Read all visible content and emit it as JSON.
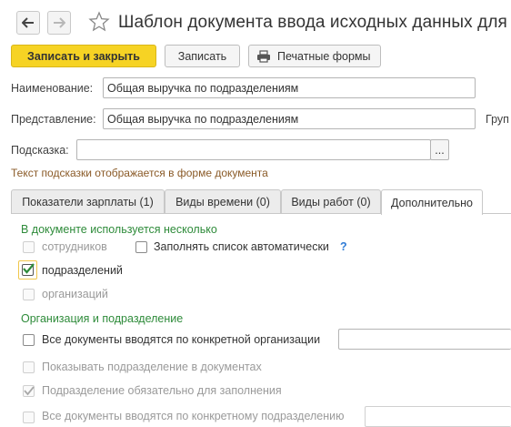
{
  "window": {
    "title": "Шаблон документа ввода исходных данных для ра"
  },
  "toolbar": {
    "save_close_label": "Записать и закрыть",
    "save_label": "Записать",
    "print_forms_label": "Печатные формы"
  },
  "form": {
    "name_label": "Наименование:",
    "name_value": "Общая выручка по подразделениям",
    "representation_label": "Представление:",
    "representation_value": "Общая выручка по подразделениям",
    "group_label_fragment": "Груп",
    "hint_label": "Подсказка:",
    "hint_value": "",
    "hint_button": "...",
    "hint_note": "Текст подсказки отображается в форме документа"
  },
  "tabs": [
    {
      "label": "Показатели зарплаты (1)"
    },
    {
      "label": "Виды времени (0)"
    },
    {
      "label": "Виды работ (0)"
    },
    {
      "label": "Дополнительно"
    }
  ],
  "additional": {
    "section1_title": "В документе используется несколько",
    "employees_label": "сотрудников",
    "autofill_label": "Заполнять список автоматически",
    "help_mark": "?",
    "departments_label": "подразделений",
    "organizations_label": "организаций",
    "section2_title": "Организация и подразделение",
    "all_docs_org_label": "Все документы вводятся по конкретной организации",
    "show_dept_label": "Показывать подразделение в документах",
    "dept_required_label": "Подразделение обязательно для заполнения",
    "all_docs_dept_label": "Все документы вводятся по конкретному подразделению"
  },
  "colors": {
    "primary_button": "#f6d324",
    "section_title": "#2e8b3a",
    "hint_note": "#8a5a27",
    "help_mark": "#2f7bd6"
  }
}
